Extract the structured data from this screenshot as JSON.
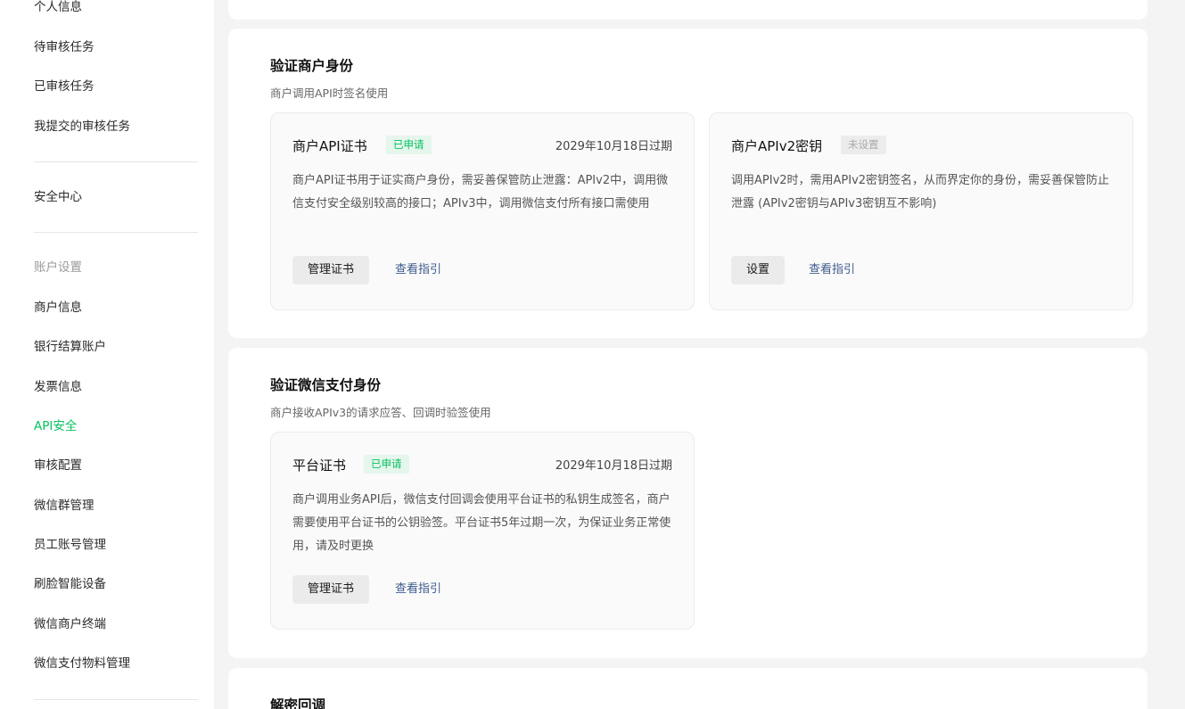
{
  "sidebar": {
    "items": [
      {
        "label": "个人信息"
      },
      {
        "label": "待审核任务"
      },
      {
        "label": "已审核任务"
      },
      {
        "label": "我提交的审核任务"
      },
      {
        "label": "安全中心"
      },
      {
        "label": "商户信息"
      },
      {
        "label": "银行结算账户"
      },
      {
        "label": "发票信息"
      },
      {
        "label": "API安全"
      },
      {
        "label": "审核配置"
      },
      {
        "label": "微信群管理"
      },
      {
        "label": "员工账号管理"
      },
      {
        "label": "刷脸智能设备"
      },
      {
        "label": "微信商户终端"
      },
      {
        "label": "微信支付物料管理"
      }
    ],
    "group_label": "账户设置",
    "active_item": "API安全"
  },
  "sections": [
    {
      "title": "验证商户身份",
      "subtitle": "商户调用API时签名使用",
      "cards": [
        {
          "title": "商户API证书",
          "badge": "已申请",
          "expiry": "2029年10月18日过期",
          "description": "商户API证书用于证实商户身份，需妥善保管防止泄露：APIv2中，调用微信支付安全级别较高的接口；APIv3中，调用微信支付所有接口需使用",
          "button": "管理证书",
          "link": "查看指引"
        },
        {
          "title": "商户APIv2密钥",
          "badge": "未设置",
          "description": "调用APIv2时，需用APIv2密钥签名，从而界定你的身份，需妥善保管防止泄露 (APIv2密钥与APIv3密钥互不影响)",
          "button": "设置",
          "link": "查看指引"
        }
      ]
    },
    {
      "title": "验证微信支付身份",
      "subtitle": "商户接收APIv3的请求应答、回调时验签使用",
      "cards": [
        {
          "title": "平台证书",
          "badge": "已申请",
          "expiry": "2029年10月18日过期",
          "description": "商户调用业务API后，微信支付回调会使用平台证书的私钥生成签名，商户需要使用平台证书的公钥验签。平台证书5年过期一次，为保证业务正常使用，请及时更换",
          "button": "管理证书",
          "link": "查看指引"
        }
      ]
    },
    {
      "title": "解密回调"
    }
  ],
  "colors": {
    "accent": "#07c160",
    "link": "#3e5b8c",
    "badge_green_bg": "#e5f6ec",
    "badge_gray_bg": "#ececec",
    "page_bg": "#f4f4f4"
  }
}
